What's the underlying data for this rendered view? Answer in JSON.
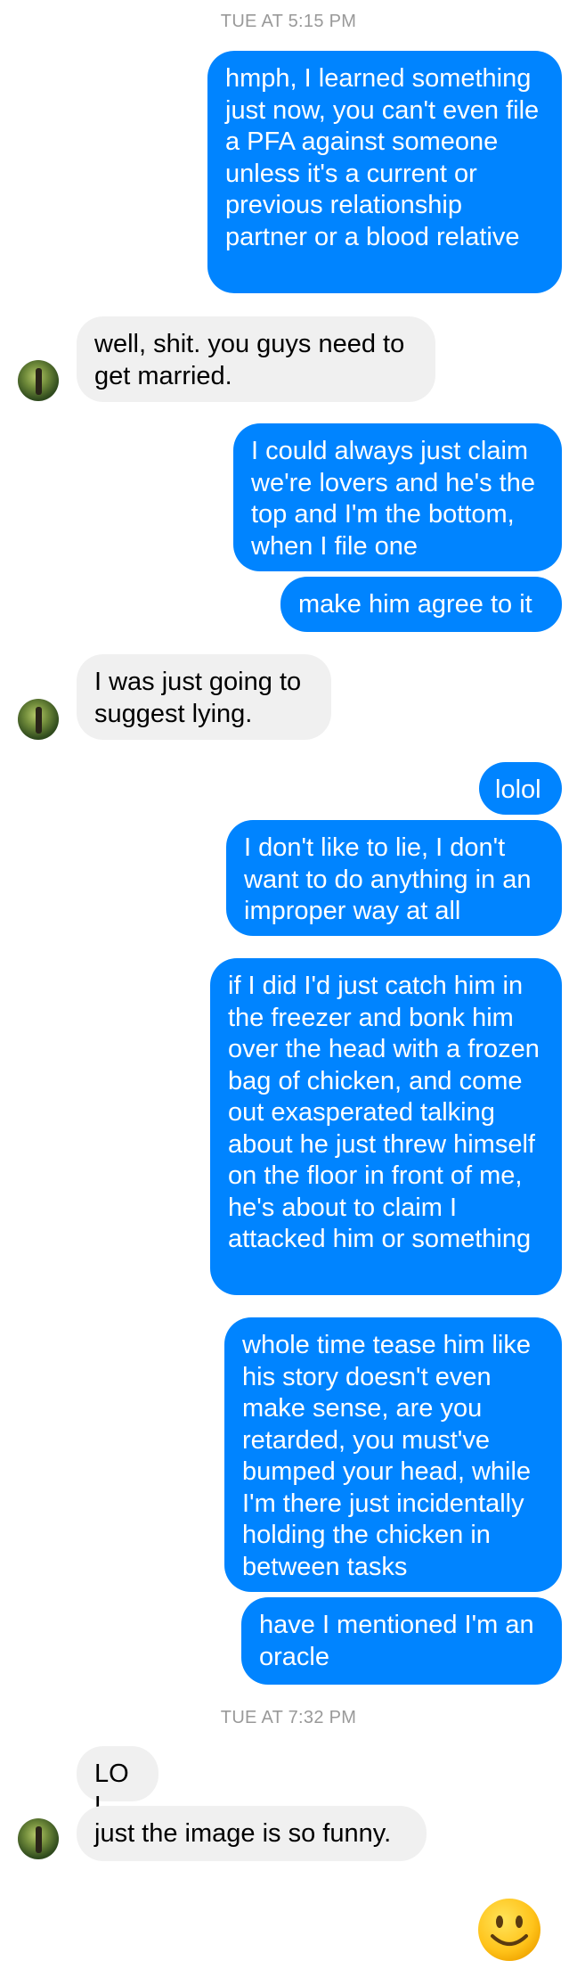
{
  "conversation": {
    "timestamp_1": "TUE AT 5:15 PM",
    "timestamp_2": "TUE AT 7:32 PM",
    "messages": [
      {
        "from": "me",
        "text": "hmph, I learned something just now, you can't even file a PFA against someone unless it's a current or previous relationship partner or a blood relative"
      },
      {
        "from": "them",
        "text": "well, shit. you guys need to get married."
      },
      {
        "from": "me",
        "text": "I could always just claim we're lovers and he's the top and I'm the bottom, when I file one"
      },
      {
        "from": "me",
        "text": "make him agree to it"
      },
      {
        "from": "them",
        "text": "I was just going to suggest lying."
      },
      {
        "from": "me",
        "text": "lolol"
      },
      {
        "from": "me",
        "text": "I don't like to lie, I don't want to do anything in an improper way at all"
      },
      {
        "from": "me",
        "text": "if I did I'd just catch him in the freezer and bonk him over the head with a frozen bag of chicken, and come out exasperated talking about he just threw himself on the floor in front of me, he's about to claim I attacked him or something"
      },
      {
        "from": "me",
        "text": "whole time tease him like his story doesn't even make sense, are you retarded, you must've bumped your head, while I'm there just incidentally holding the chicken in between tasks"
      },
      {
        "from": "me",
        "text": "have I mentioned I'm an oracle"
      },
      {
        "from": "them",
        "text": "LOL"
      },
      {
        "from": "them",
        "text": "just the image is so funny."
      }
    ],
    "reaction_emoji": "smiley-face"
  },
  "colors": {
    "outgoing_bubble": "#0084ff",
    "incoming_bubble": "#f0f0f0",
    "timestamp": "#999999"
  }
}
